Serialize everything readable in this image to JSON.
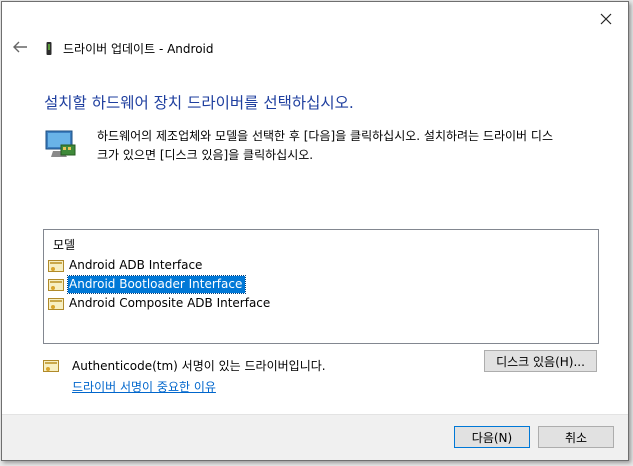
{
  "window": {
    "title": "드라이버 업데이트 - Android"
  },
  "heading": "설치할 하드웨어 장치 드라이버를 선택하십시오.",
  "instruction": {
    "line1": "하드웨어의 제조업체와 모델을 선택한 후 [다음]을 클릭하십시오. 설치하려는 드라이버 디스",
    "line2": "크가 있으면 [디스크 있음]을 클릭하십시오."
  },
  "model_list": {
    "header": "모델",
    "items": [
      {
        "label": "Android ADB Interface",
        "selected": false
      },
      {
        "label": "Android Bootloader Interface",
        "selected": true
      },
      {
        "label": "Android Composite ADB Interface",
        "selected": false
      }
    ]
  },
  "signature": {
    "text": "Authenticode(tm) 서명이 있는 드라이버입니다.",
    "link": "드라이버 서명이 중요한 이유"
  },
  "buttons": {
    "have_disk": "디스크 있음(H)...",
    "next": "다음(N)",
    "cancel": "취소"
  },
  "colors": {
    "heading": "#1f3f9f",
    "selection": "#0078d7",
    "link": "#0066cc"
  },
  "icons": {
    "close": "close-icon",
    "back": "back-arrow-icon",
    "title": "usb-device-icon",
    "hardware": "hardware-monitor-icon",
    "driver": "driver-certificate-icon"
  }
}
